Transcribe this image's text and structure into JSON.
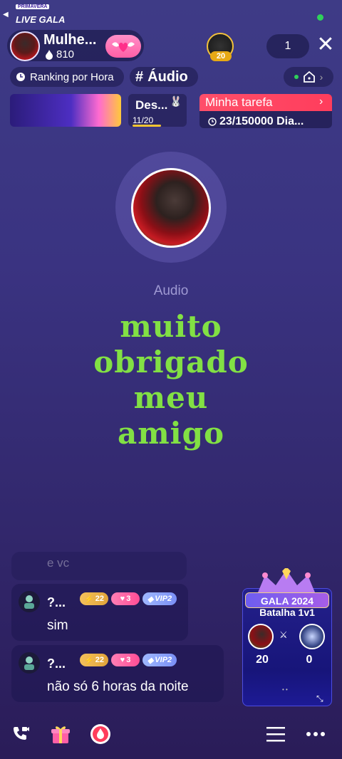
{
  "header": {
    "host_name": "Mulhe...",
    "host_fans": "810",
    "top_viewer_level": "20",
    "viewer_count": "1",
    "close_symbol": "✕"
  },
  "tags": {
    "ranking_label": "Ranking por Hora",
    "audio_label": "Áudio"
  },
  "banner": {
    "small": "PRIMAVERA",
    "title": "LIVE GALA"
  },
  "task_des": {
    "label": "Des...",
    "count": "11/20"
  },
  "mission": {
    "title": "Minha tarefa",
    "progress": "23/150000 Dia..."
  },
  "center": {
    "label": "Audio",
    "message_lines": [
      "muito",
      "obrigado",
      "meu",
      "amigo"
    ]
  },
  "chat": {
    "faded_text": "e vc",
    "messages": [
      {
        "name": "?...",
        "level": "22",
        "hearts": "3",
        "vip": "VIP2",
        "text": "sim"
      },
      {
        "name": "?...",
        "level": "22",
        "hearts": "3",
        "vip": "VIP2",
        "text": "não só 6 horas da noite"
      }
    ]
  },
  "battle": {
    "title": "GALA 2024",
    "subtitle": "Batalha 1v1",
    "score_left": "20",
    "score_right": "0"
  },
  "colors": {
    "accent_green": "#82e044",
    "mission_red": "#ff4f6a",
    "follow_pink": "#ff5fa6"
  }
}
